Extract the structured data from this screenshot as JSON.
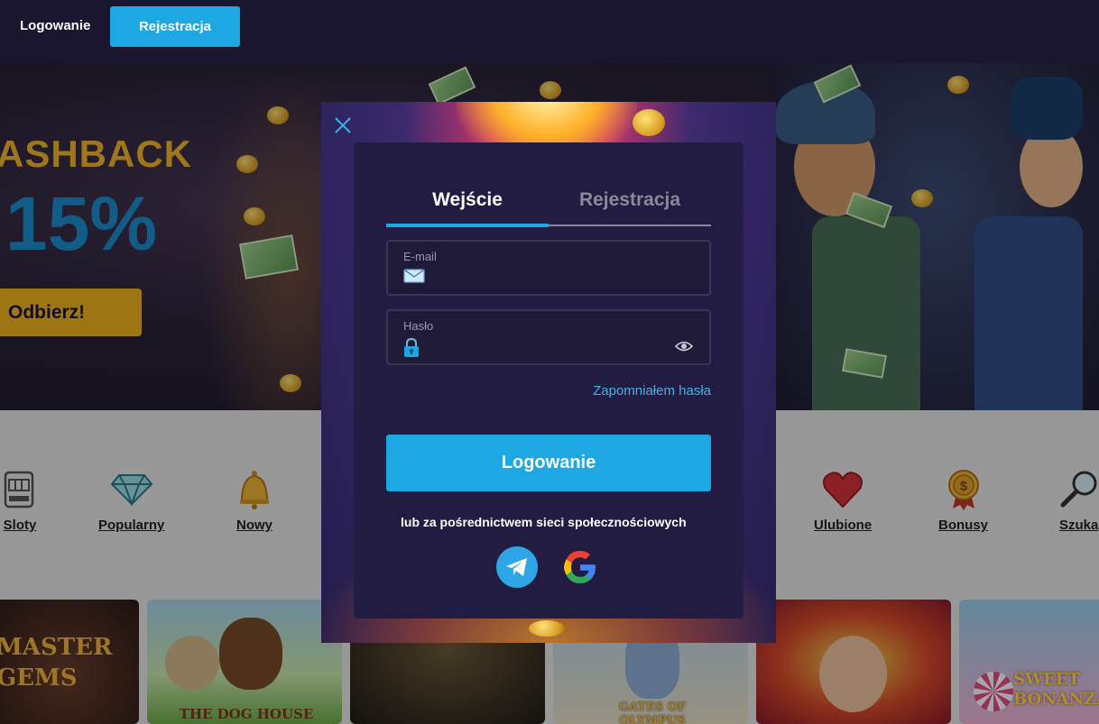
{
  "topbar": {
    "login_label": "Logowanie",
    "register_label": "Rejestracja"
  },
  "hero": {
    "headline": "ASHBACK",
    "percent": "15%",
    "cta_label": "Odbierz!"
  },
  "categories": [
    {
      "label": "Sloty",
      "icon": "slot-machine-icon"
    },
    {
      "label": "Popularny",
      "icon": "diamond-icon"
    },
    {
      "label": "Nowy",
      "icon": "bell-icon"
    },
    {
      "label": "Ulubione",
      "icon": "heart-icon"
    },
    {
      "label": "Bonusy",
      "icon": "bonus-medal-icon"
    },
    {
      "label": "Szuka",
      "icon": "search-icon"
    }
  ],
  "games": [
    {
      "title": "MASTER GEMS"
    },
    {
      "title": "THE DOG HOUSE"
    },
    {
      "title": ""
    },
    {
      "title": "GATES OF OLYMPUS"
    },
    {
      "title": ""
    },
    {
      "title": "SWEET BONANZA"
    }
  ],
  "modal": {
    "tabs": {
      "login": "Wejście",
      "register": "Rejestracja"
    },
    "email": {
      "label": "E-mail",
      "value": ""
    },
    "password": {
      "label": "Hasło",
      "value": ""
    },
    "forgot_label": "Zapomniałem hasła",
    "submit_label": "Logowanie",
    "social_text": "lub za pośrednictwem sieci społecznościowych",
    "social": [
      "telegram-icon",
      "google-icon"
    ]
  },
  "colors": {
    "accent": "#1ea8e3",
    "panel": "#221c42",
    "gold": "#f2b41e"
  }
}
